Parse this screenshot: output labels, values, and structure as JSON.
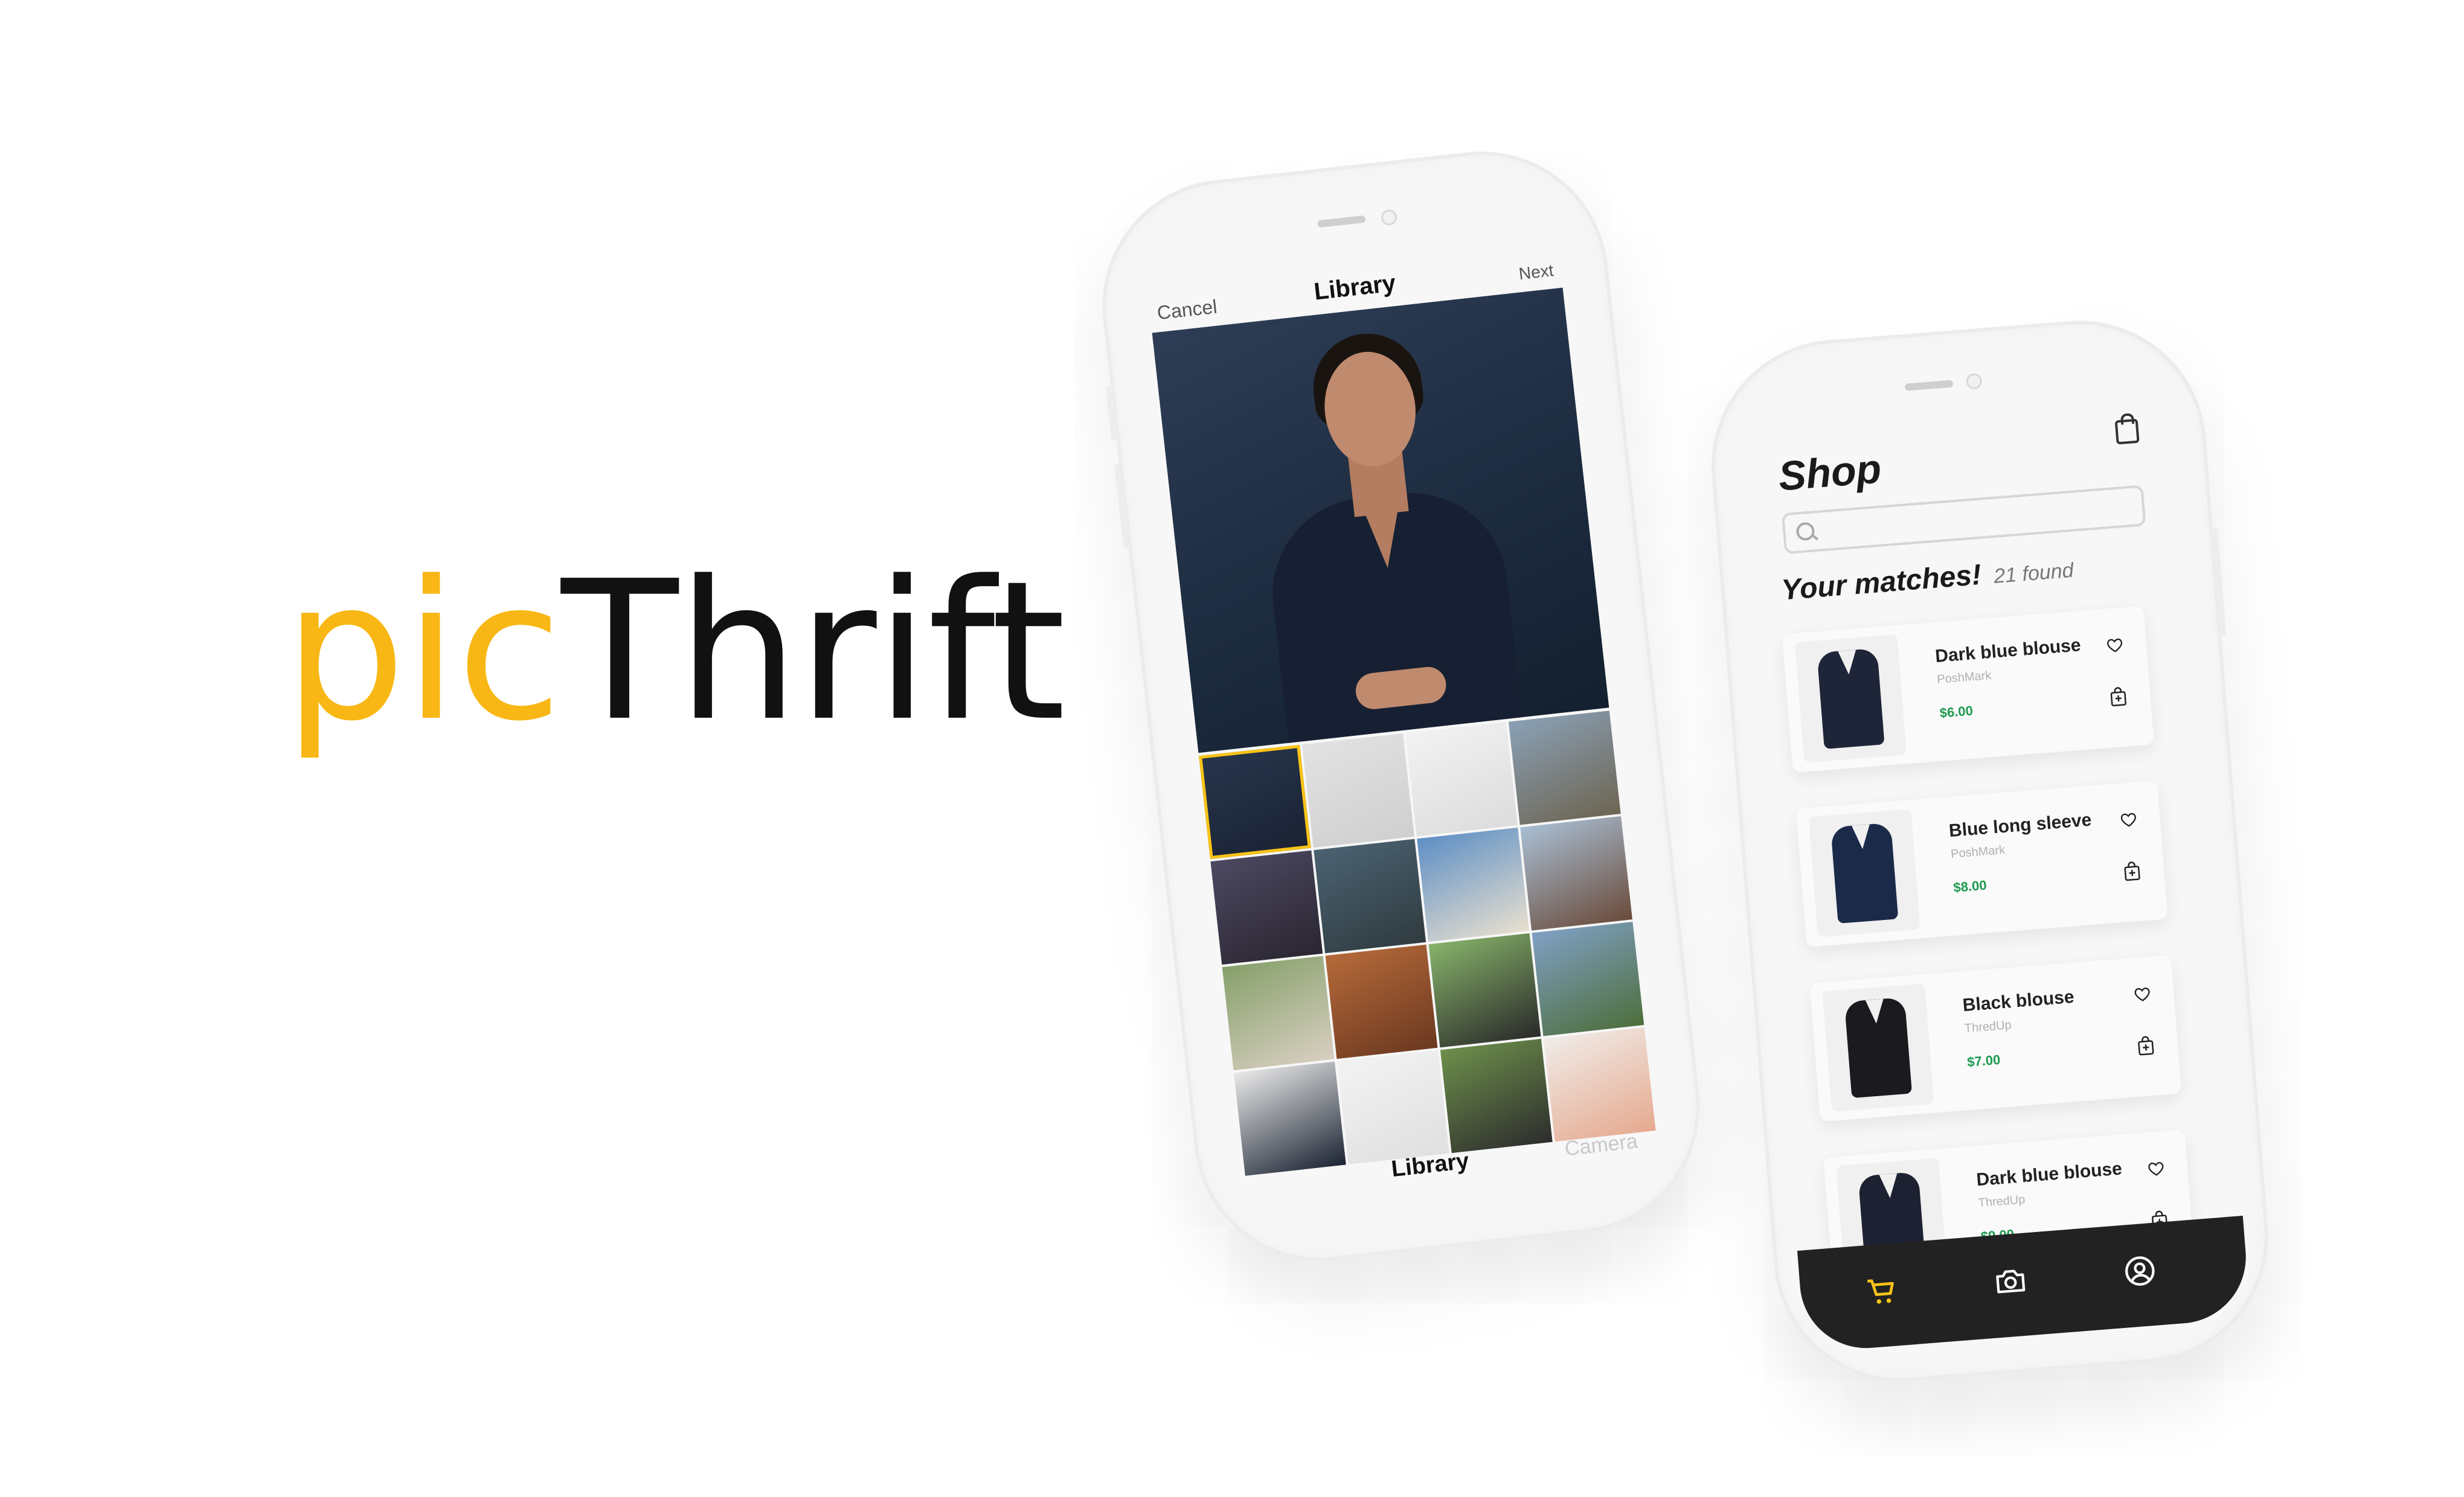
{
  "brand": {
    "part1": "pic",
    "part2": "Thrift",
    "colors": {
      "accent": "#f9b715",
      "dark": "#111111"
    }
  },
  "library_screen": {
    "cancel": "Cancel",
    "title": "Library",
    "next": "Next",
    "thumbnails": [
      {
        "name": "portrait",
        "colors": [
          "#27354c",
          "#1a2233"
        ],
        "selected": true
      },
      {
        "name": "document",
        "colors": [
          "#e2e2e2",
          "#cfcfcf"
        ]
      },
      {
        "name": "handwritten-notes",
        "colors": [
          "#f2f2f2",
          "#dcdcdc"
        ]
      },
      {
        "name": "castle-goat",
        "colors": [
          "#8aa0b6",
          "#6d6552"
        ]
      },
      {
        "name": "purple-flower",
        "colors": [
          "#4c4962",
          "#2a2530"
        ]
      },
      {
        "name": "coastline",
        "colors": [
          "#4b6272",
          "#2f3b3f"
        ]
      },
      {
        "name": "santorini",
        "colors": [
          "#5e8fc5",
          "#e8e0cf"
        ]
      },
      {
        "name": "rooftops",
        "colors": [
          "#a9bfd4",
          "#6a4b3b"
        ]
      },
      {
        "name": "cow",
        "colors": [
          "#86a06a",
          "#d9cfc2"
        ]
      },
      {
        "name": "canyon",
        "colors": [
          "#b66a3a",
          "#6b3820"
        ]
      },
      {
        "name": "cow-field",
        "colors": [
          "#87b36a",
          "#2a2a2a"
        ]
      },
      {
        "name": "landscape",
        "colors": [
          "#7fa0c4",
          "#4e6e3c"
        ]
      },
      {
        "name": "portrait-2",
        "colors": [
          "#eaeaea",
          "#1c2433"
        ]
      },
      {
        "name": "room",
        "colors": [
          "#f2f2f2",
          "#e0e0e0"
        ]
      },
      {
        "name": "panda",
        "colors": [
          "#6d8f4b",
          "#2d2d2d"
        ]
      },
      {
        "name": "sky",
        "colors": [
          "#f0ece8",
          "#e6a98f"
        ]
      }
    ],
    "tab_library": "Library",
    "tab_camera": "Camera"
  },
  "shop_screen": {
    "title": "Shop",
    "search_placeholder": "",
    "matches_title": "Your matches!",
    "matches_count": "21 found",
    "items": [
      {
        "name": "Dark blue blouse",
        "source": "PoshMark",
        "price": "$6.00",
        "color": "#1e2538"
      },
      {
        "name": "Blue long sleeve",
        "source": "PoshMark",
        "price": "$8.00",
        "color": "#1c2a4a"
      },
      {
        "name": "Black blouse",
        "source": "ThredUp",
        "price": "$7.00",
        "color": "#1b1b1f"
      },
      {
        "name": "Dark blue blouse",
        "source": "ThredUp",
        "price": "$9.00",
        "color": "#1d2131"
      }
    ],
    "tabs": [
      "cart",
      "camera",
      "profile"
    ],
    "active_tab_color": "#f9c316",
    "inactive_tab_color": "#ffffff"
  }
}
